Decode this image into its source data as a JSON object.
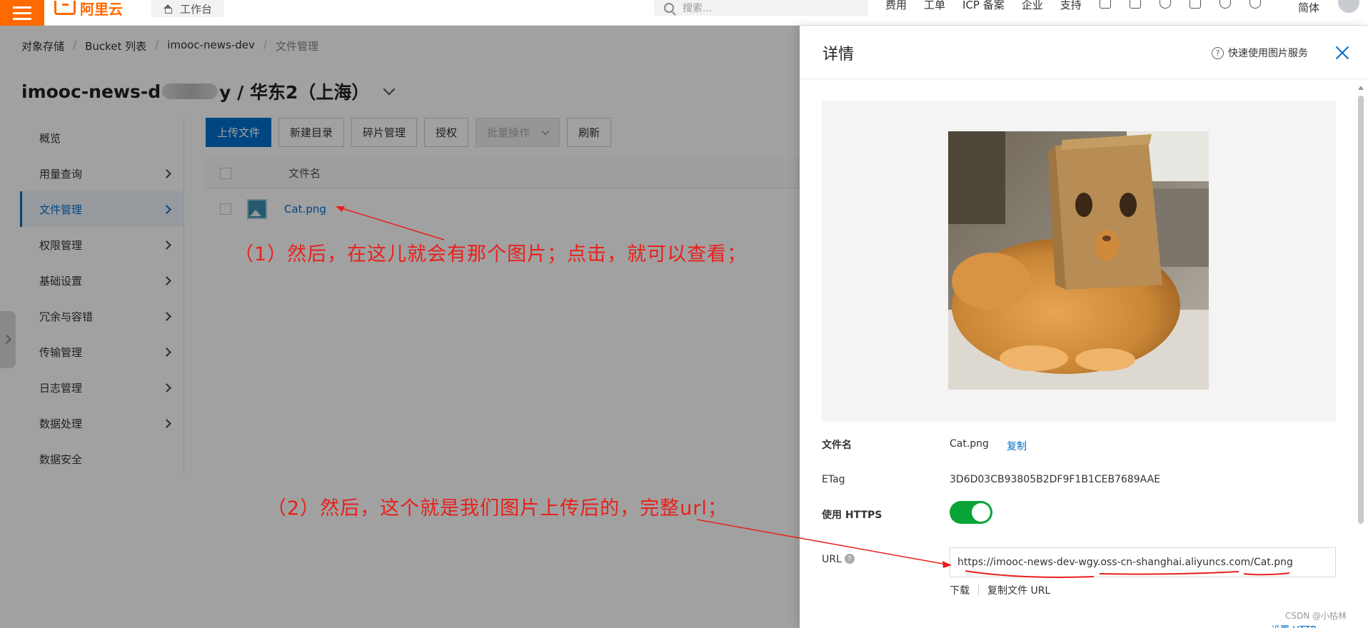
{
  "topbar": {
    "logo_text": "阿里云",
    "workbench_label": "工作台",
    "search_placeholder": "搜索...",
    "nav": [
      "费用",
      "工单",
      "ICP 备案",
      "企业",
      "支持"
    ],
    "lang": "简体"
  },
  "breadcrumb": [
    "对象存储",
    "Bucket 列表",
    "imooc-news-dev",
    "文件管理"
  ],
  "page_title": {
    "prefix": "imooc-news-d",
    "suffix": "y / 华东2（上海）"
  },
  "side_nav": [
    {
      "label": "概览",
      "arrow": false
    },
    {
      "label": "用量查询",
      "arrow": true
    },
    {
      "label": "文件管理",
      "arrow": true,
      "active": true
    },
    {
      "label": "权限管理",
      "arrow": true
    },
    {
      "label": "基础设置",
      "arrow": true
    },
    {
      "label": "冗余与容错",
      "arrow": true
    },
    {
      "label": "传输管理",
      "arrow": true
    },
    {
      "label": "日志管理",
      "arrow": true
    },
    {
      "label": "数据处理",
      "arrow": true
    },
    {
      "label": "数据安全",
      "arrow": false
    }
  ],
  "toolbar": {
    "upload": "上传文件",
    "new_dir": "新建目录",
    "fragments": "碎片管理",
    "authorize": "授权",
    "batch": "批量操作",
    "refresh": "刷新"
  },
  "table": {
    "col_name": "文件名",
    "rows": [
      {
        "name": "Cat.png"
      }
    ]
  },
  "panel": {
    "title": "详情",
    "quick_link": "快速使用图片服务",
    "fields": {
      "filename_label": "文件名",
      "filename_value": "Cat.png",
      "copy": "复制",
      "etag_label": "ETag",
      "etag_value": "3D6D03CB93805B2DF9F1B1CEB7689AAE",
      "https_label": "使用 HTTPS",
      "url_label": "URL",
      "url_value": "https://imooc-news-dev-wgy.oss-cn-shanghai.aliyuncs.com/Cat.png",
      "download": "下载",
      "copy_url": "复制文件 URL"
    },
    "bottom_link": "设置 HTTP..."
  },
  "annotations": {
    "note1": "（1）然后，在这儿就会有那个图片；点击，就可以查看；",
    "note2": "（2）然后，这个就是我们图片上传后的，完整url；"
  },
  "watermark": "CSDN @小枯林",
  "colors": {
    "brand": "#ff6a00",
    "primary": "#0070cc",
    "toggle_on": "#09a437",
    "annotation": "#e8201b"
  }
}
